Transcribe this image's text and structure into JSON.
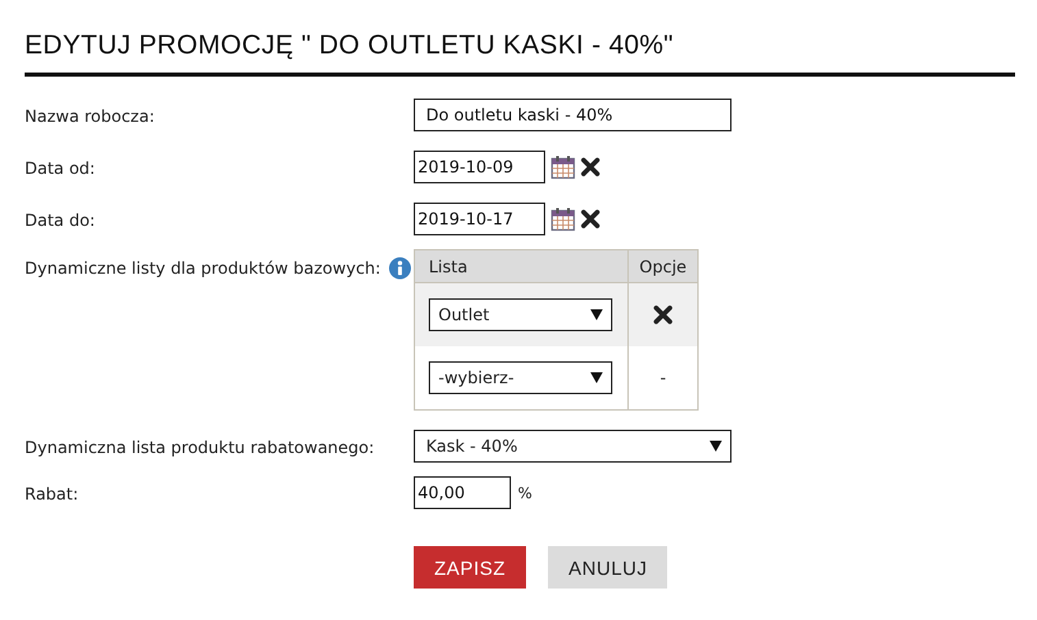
{
  "title": "EDYTUJ PROMOCJĘ \" DO OUTLETU KASKI - 40%\"",
  "fields": [
    {
      "kind": "text",
      "label": "Nazwa robocza:",
      "value": "Do outletu kaski - 40%"
    },
    {
      "kind": "date",
      "label": "Data od:",
      "value": "2019-10-09"
    },
    {
      "kind": "date",
      "label": "Data do:",
      "value": "2019-10-17"
    },
    {
      "kind": "table",
      "label": "Dynamiczne listy dla produktów bazowych:",
      "columns": [
        "Lista",
        "Opcje"
      ],
      "rows": [
        {
          "value": "Outlet",
          "removable": true
        },
        {
          "value": "-wybierz-",
          "removable": false,
          "option": "-"
        }
      ]
    },
    {
      "kind": "select",
      "label": "Dynamiczna lista produktu rabatowanego:",
      "value": "Kask - 40%"
    },
    {
      "kind": "number",
      "label": "Rabat:",
      "value": "40,00",
      "unit": "%"
    }
  ],
  "buttons": [
    {
      "label": "ZAPISZ",
      "kind": "primary"
    },
    {
      "label": "ANULUJ",
      "kind": "secondary"
    }
  ]
}
